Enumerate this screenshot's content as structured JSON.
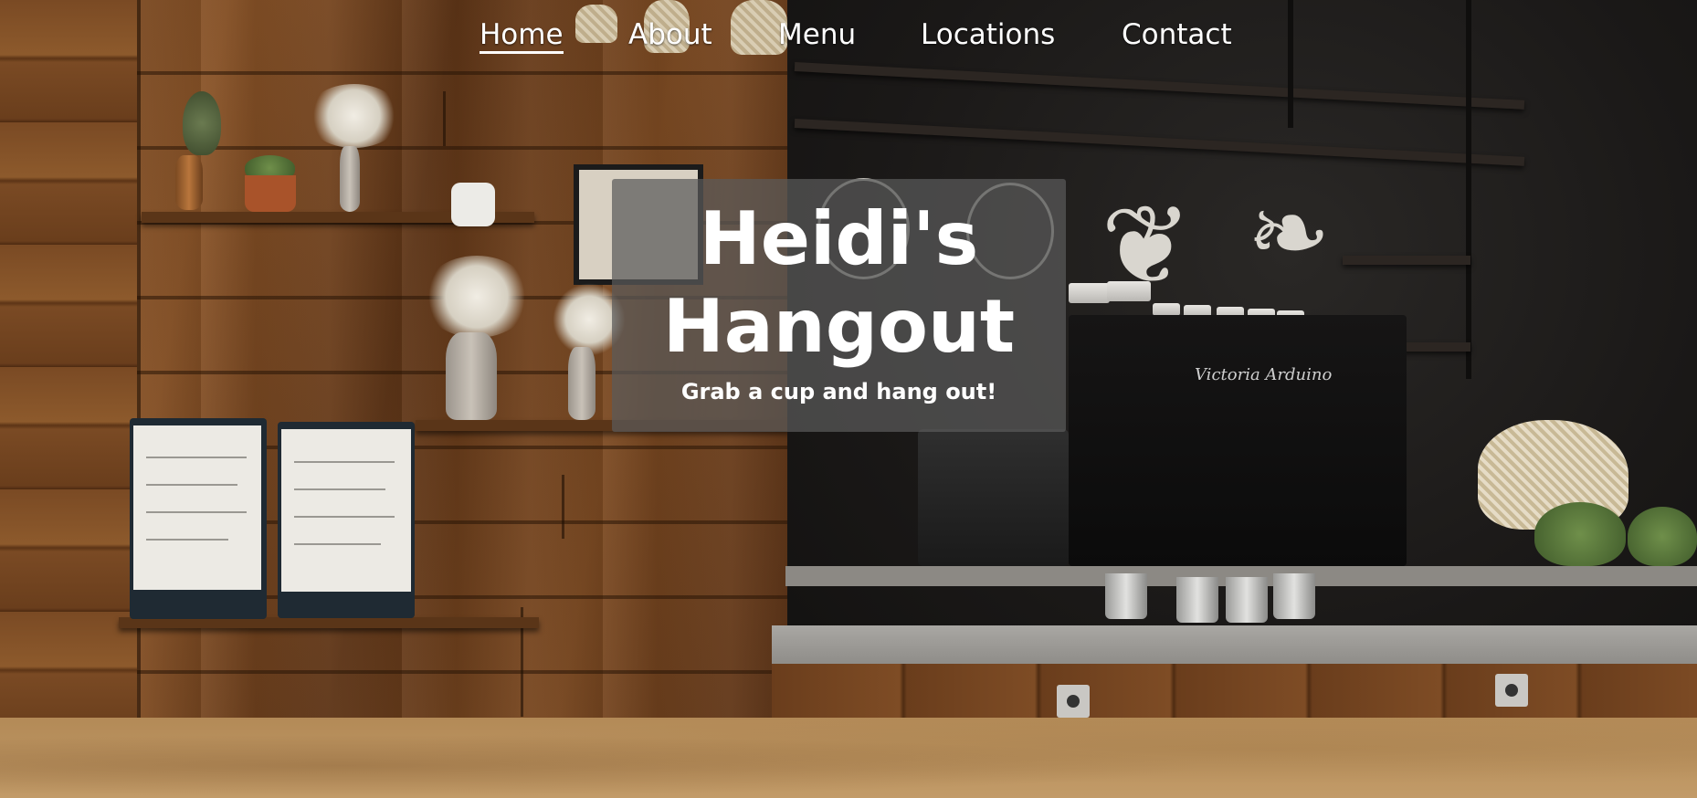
{
  "nav": {
    "links": [
      {
        "label": "Home",
        "active": true
      },
      {
        "label": "About",
        "active": false
      },
      {
        "label": "Menu",
        "active": false
      },
      {
        "label": "Locations",
        "active": false
      },
      {
        "label": "Contact",
        "active": false
      }
    ]
  },
  "hero": {
    "title_line1": "Heidi's",
    "title_line2": "Hangout",
    "tagline": "Grab a cup and hang out!",
    "machine_brand": "Victoria Arduino"
  },
  "colors": {
    "nav_text": "#ffffff",
    "title_card_bg": "#5a5a5a",
    "footer_band": "#b38a57"
  }
}
